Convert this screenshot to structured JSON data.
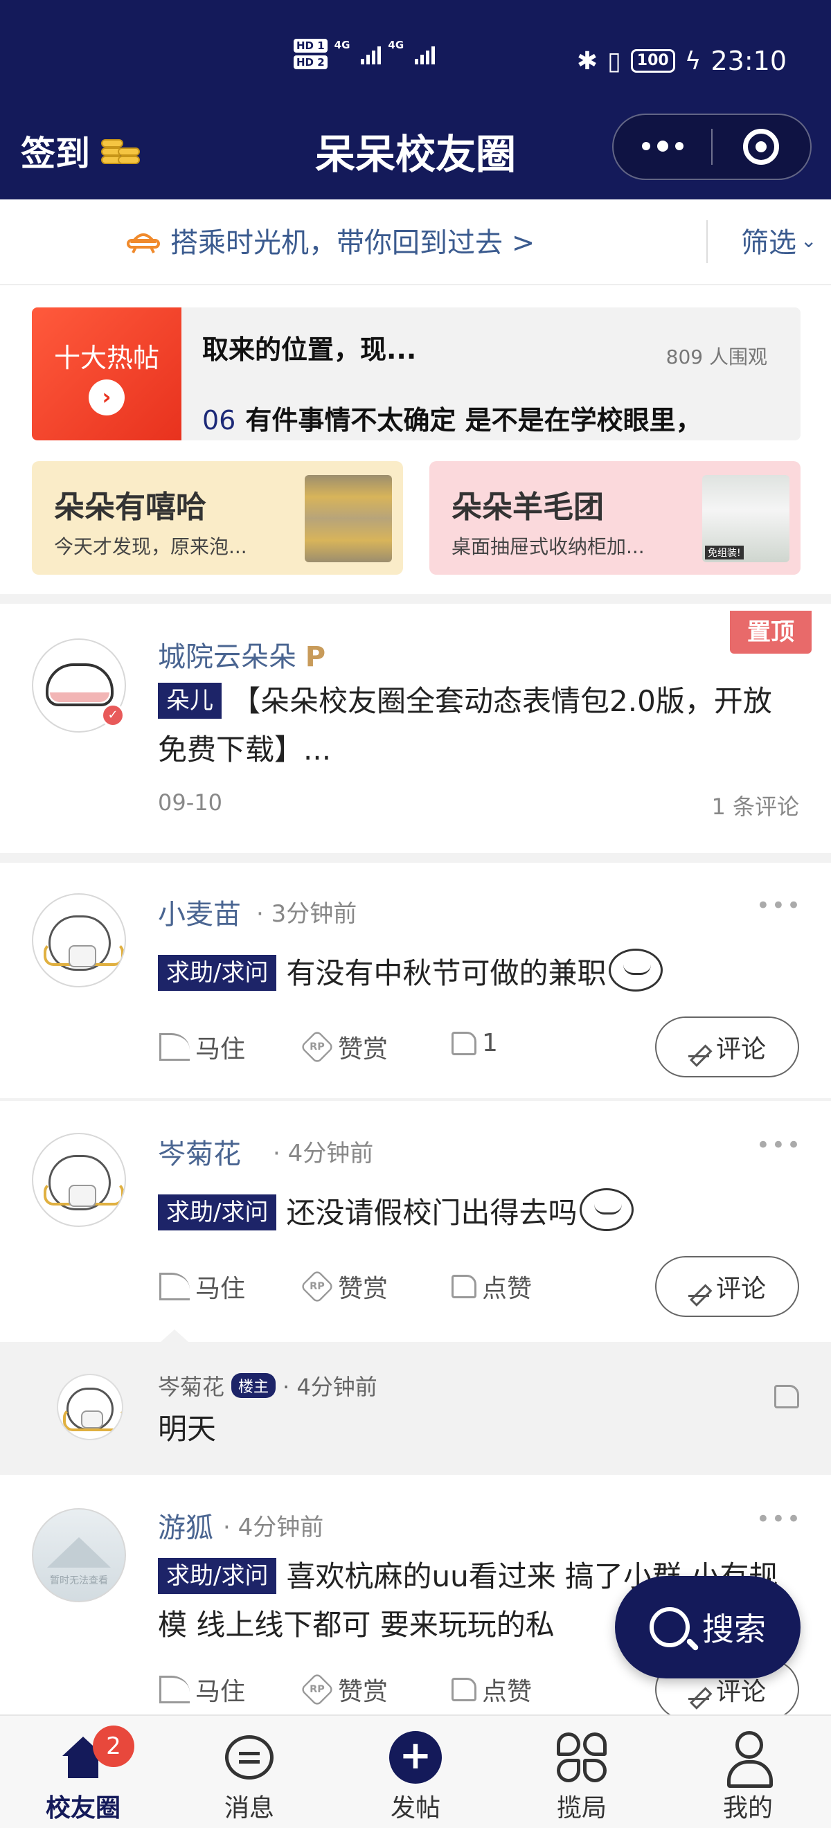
{
  "status_bar": {
    "hd1": "HD 1",
    "hd2": "HD 2",
    "net1": "4G",
    "net2": "4G",
    "battery": "100",
    "time": "23:10"
  },
  "header": {
    "checkin": "签到",
    "title": "呆呆校友圈"
  },
  "time_machine": {
    "text": "搭乘时光机，带你回到过去 >",
    "filter": "筛选"
  },
  "hot_posts": {
    "badge": "十大热帖",
    "line1": "取来的位置，现...",
    "views": "809 人围观",
    "item2_num": "06",
    "item2_text": "有件事情不太确定 是不是在学校眼里，"
  },
  "cards": [
    {
      "title": "朵朵有嘻哈",
      "subtitle": "今天才发现，原来泡..."
    },
    {
      "title": "朵朵羊毛团",
      "subtitle": "桌面抽屉式收纳柜加...",
      "thumb_tag": "免组装!"
    }
  ],
  "pinned_post": {
    "badge": "置顶",
    "author": "城院云朵朵",
    "level": "P",
    "tag": "朵儿",
    "content": "【朵朵校友圈全套动态表情包2.0版，开放免费下载】...",
    "date": "09-10",
    "comments": "1 条评论"
  },
  "actions": {
    "ride": "马住",
    "reward": "赞赏",
    "like": "点赞",
    "comment": "评论"
  },
  "posts": [
    {
      "author": "小麦苗",
      "time": "· 3分钟前",
      "tag": "求助/求问",
      "content": "有没有中秋节可做的兼职",
      "likes": "1"
    },
    {
      "author": "岑菊花",
      "time": "· 4分钟前",
      "tag": "求助/求问",
      "content": "还没请假校门出得去吗"
    },
    {
      "author": "游狐",
      "time": "· 4分钟前",
      "tag": "求助/求问",
      "content": "喜欢杭麻的uu看过来 搞了小群 小有规模 线上线下都可 要来玩玩的私",
      "avatar_text": "暂时无法查看"
    }
  ],
  "reply": {
    "author": "岑菊花",
    "badge": "楼主",
    "time": "· 4分钟前",
    "content": "明天"
  },
  "search_fab": "搜索",
  "bottom_nav": {
    "items": [
      {
        "label": "校友圈",
        "badge": "2"
      },
      {
        "label": "消息"
      },
      {
        "label": "发帖"
      },
      {
        "label": "揽局"
      },
      {
        "label": "我的"
      }
    ]
  },
  "colors": {
    "brand": "#141a5a",
    "hot_red": "#e8321e",
    "pin_red": "#e86a6a",
    "name_blue": "#4a6591"
  }
}
